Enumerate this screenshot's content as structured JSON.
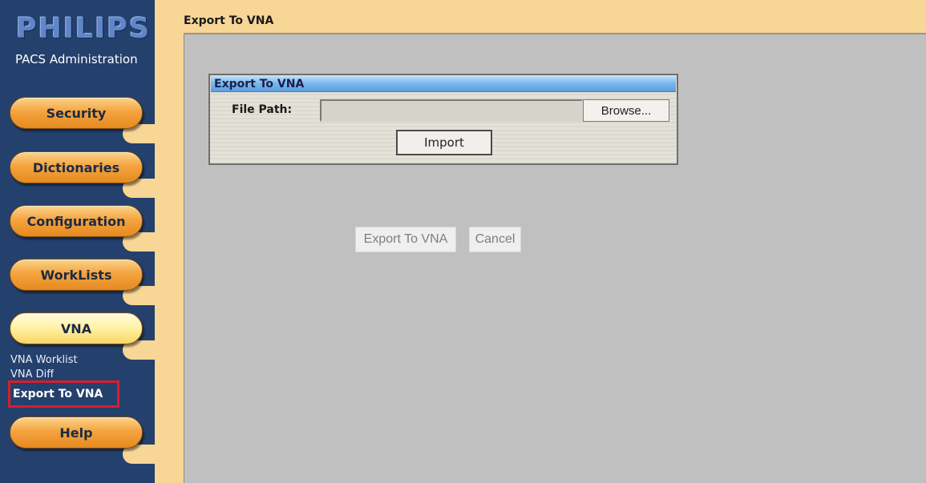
{
  "sidebar": {
    "brand": "PHILIPS",
    "subtitle": "PACS Administration",
    "nav": {
      "security": "Security",
      "dictionaries": "Dictionaries",
      "configuration": "Configuration",
      "worklists": "WorkLists",
      "vna": "VNA",
      "help": "Help"
    },
    "vna_links": {
      "worklist": "VNA Worklist",
      "diff": "VNA Diff",
      "export": "Export To VNA"
    }
  },
  "header": {
    "title": "Export To VNA"
  },
  "panel": {
    "title": "Export To VNA",
    "file_path_label": "File Path:",
    "file_path_value": "",
    "browse_label": "Browse...",
    "import_label": "Import"
  },
  "actions": {
    "export_label": "Export To VNA",
    "cancel_label": "Cancel"
  },
  "colors": {
    "sidebar_bg": "#24406c",
    "accent_orange": "#f4a440",
    "highlight_red": "#d81e2a",
    "panel_title_blue": "#7cb9ec",
    "content_gray": "#c0c0c0"
  }
}
